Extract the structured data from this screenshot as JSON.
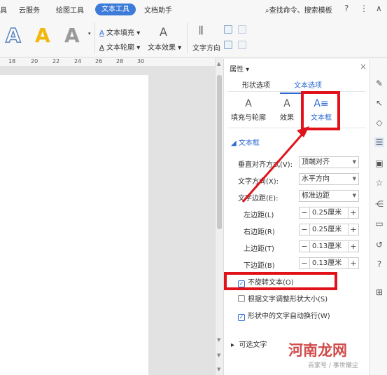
{
  "menu": {
    "items": [
      "具",
      "云服务",
      "绘图工具",
      "文本工具",
      "文档助手"
    ],
    "active": "文本工具",
    "search": "查找命令、搜索模板",
    "help": "?",
    "more": "⋮",
    "collapse": "∧"
  },
  "ribbon": {
    "style_glyph": "A",
    "text_fill": "文本填充",
    "text_outline": "文本轮廓",
    "text_effect": "文本效果",
    "text_direction": "文字方向",
    "text_icon": "A"
  },
  "ruler": {
    "ticks": [
      "18",
      "20",
      "22",
      "24",
      "26",
      "28",
      "30"
    ]
  },
  "panel": {
    "title": "属性",
    "close": "×",
    "tabs": [
      "形状选项",
      "文本选项"
    ],
    "active_tab": "文本选项",
    "sub_tabs": [
      {
        "label": "填充与轮廓",
        "icon": "A"
      },
      {
        "label": "效果",
        "icon": "A"
      },
      {
        "label": "文本框",
        "icon": "A≡"
      }
    ],
    "active_sub_tab": "文本框",
    "section": "文本框",
    "vertical_align_label": "垂直对齐方式(V):",
    "vertical_align_value": "顶端对齐",
    "text_direction_label": "文字方向(X):",
    "text_direction_value": "水平方向",
    "text_margin_label": "文字边距(E):",
    "text_margin_value": "标准边距",
    "margins": [
      {
        "label": "左边距(L)",
        "value": "0.25厘米"
      },
      {
        "label": "右边距(R)",
        "value": "0.25厘米"
      },
      {
        "label": "上边距(T)",
        "value": "0.13厘米"
      },
      {
        "label": "下边距(B)",
        "value": "0.13厘米"
      }
    ],
    "checks": [
      {
        "label": "不旋转文本(O)",
        "checked": true
      },
      {
        "label": "根据文字调整形状大小(S)",
        "checked": false
      },
      {
        "label": "形状中的文字自动换行(W)",
        "checked": true
      }
    ],
    "optional_text": "可选文字"
  },
  "right_toolbar": [
    "pen-icon",
    "pointer-icon",
    "shapes-icon",
    "settings-icon",
    "image-icon",
    "star-icon",
    "share-icon",
    "archive-icon",
    "history-icon",
    "help-icon",
    "grid-icon"
  ],
  "watermark": {
    "main": "河南龙网",
    "sub": "百家号 / 事世懒尘"
  },
  "colors": {
    "accent": "#2d6bd3",
    "annotation": "#e0131a",
    "menu_active": "#3d7bd9"
  }
}
